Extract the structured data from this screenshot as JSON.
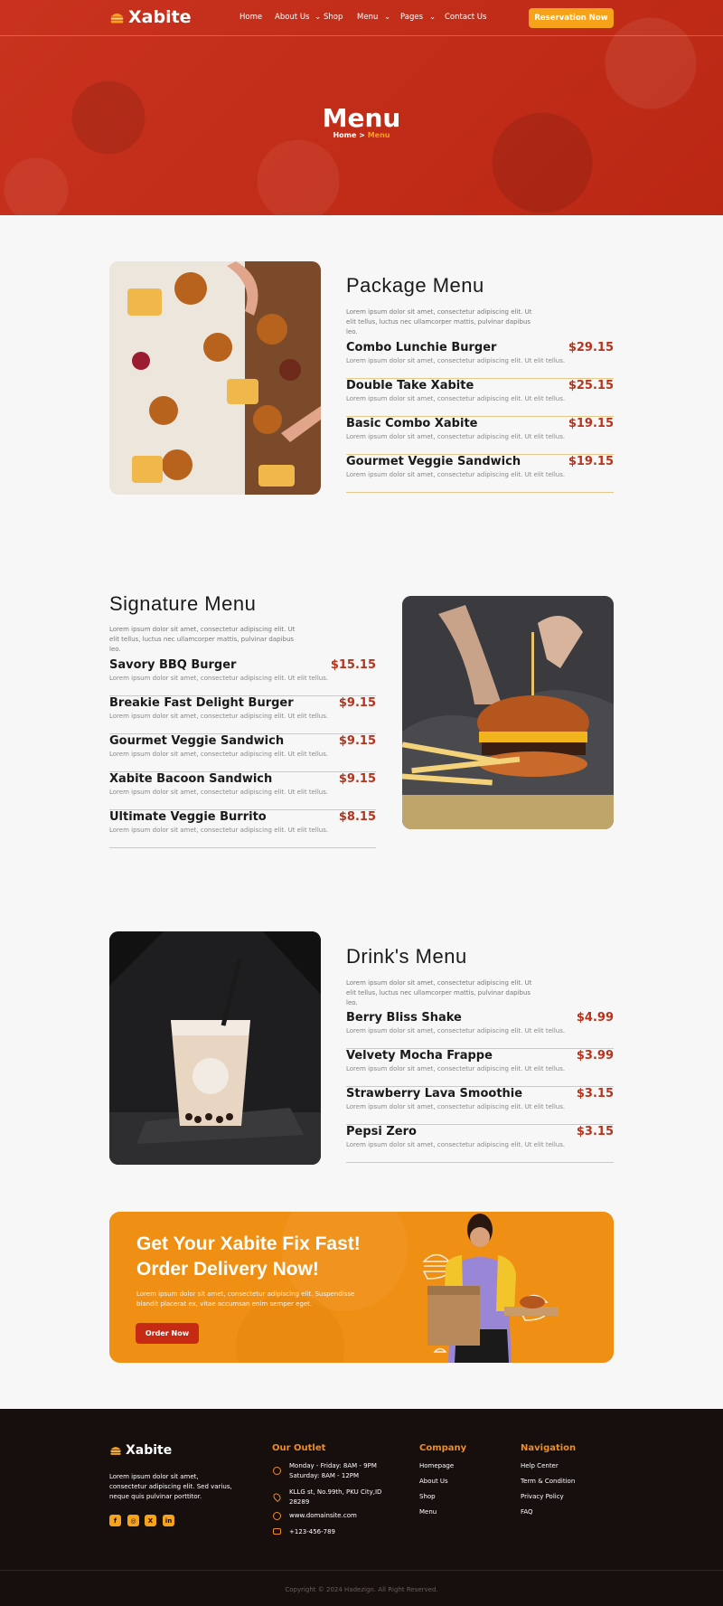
{
  "brand": "Xabite",
  "nav": {
    "items": [
      "Home",
      "About Us",
      "Shop",
      "Menu",
      "Pages",
      "Contact Us"
    ],
    "cta": "Reservation Now"
  },
  "hero": {
    "title": "Menu",
    "crumb_home": "Home",
    "crumb_sep": " > ",
    "crumb_current": "Menu"
  },
  "package": {
    "title": "Package Menu",
    "intro": "Lorem ipsum dolor sit amet, consectetur adipiscing elit. Ut elit tellus, luctus nec ullamcorper mattis, pulvinar dapibus leo.",
    "items": [
      {
        "name": "Combo Lunchie Burger",
        "price": "$29.15",
        "desc": "Lorem ipsum dolor sit amet, consectetur adipiscing elit. Ut elit tellus."
      },
      {
        "name": "Double Take Xabite",
        "price": "$25.15",
        "desc": "Lorem ipsum dolor sit amet, consectetur adipiscing elit. Ut elit tellus."
      },
      {
        "name": "Basic Combo Xabite",
        "price": "$19.15",
        "desc": "Lorem ipsum dolor sit amet, consectetur adipiscing elit. Ut elit tellus."
      },
      {
        "name": "Gourmet Veggie Sandwich",
        "price": "$19.15",
        "desc": "Lorem ipsum dolor sit amet, consectetur adipiscing elit. Ut elit tellus."
      }
    ]
  },
  "signature": {
    "title": "Signature Menu",
    "intro": "Lorem ipsum dolor sit amet, consectetur adipiscing elit. Ut elit tellus, luctus nec ullamcorper mattis, pulvinar dapibus leo.",
    "items": [
      {
        "name": "Savory BBQ Burger",
        "price": "$15.15",
        "desc": "Lorem ipsum dolor sit amet, consectetur adipiscing elit. Ut elit tellus."
      },
      {
        "name": "Breakie Fast Delight Burger",
        "price": "$9.15",
        "desc": "Lorem ipsum dolor sit amet, consectetur adipiscing elit. Ut elit tellus."
      },
      {
        "name": "Gourmet Veggie Sandwich",
        "price": "$9.15",
        "desc": "Lorem ipsum dolor sit amet, consectetur adipiscing elit. Ut elit tellus."
      },
      {
        "name": "Xabite Bacoon Sandwich",
        "price": "$9.15",
        "desc": "Lorem ipsum dolor sit amet, consectetur adipiscing elit. Ut elit tellus."
      },
      {
        "name": "Ultimate Veggie Burrito",
        "price": "$8.15",
        "desc": "Lorem ipsum dolor sit amet, consectetur adipiscing elit. Ut elit tellus."
      }
    ]
  },
  "drinks": {
    "title": "Drink's Menu",
    "intro": "Lorem ipsum dolor sit amet, consectetur adipiscing elit. Ut elit tellus, luctus nec ullamcorper mattis, pulvinar dapibus leo.",
    "items": [
      {
        "name": "Berry Bliss Shake",
        "price": "$4.99",
        "desc": "Lorem ipsum dolor sit amet, consectetur adipiscing elit. Ut elit tellus."
      },
      {
        "name": "Velvety Mocha Frappe",
        "price": "$3.99",
        "desc": "Lorem ipsum dolor sit amet, consectetur adipiscing elit. Ut elit tellus."
      },
      {
        "name": "Strawberry Lava Smoothie",
        "price": "$3.15",
        "desc": "Lorem ipsum dolor sit amet, consectetur adipiscing elit. Ut elit tellus."
      },
      {
        "name": "Pepsi Zero",
        "price": "$3.15",
        "desc": "Lorem ipsum dolor sit amet, consectetur adipiscing elit. Ut elit tellus."
      }
    ]
  },
  "banner": {
    "title_line1": "Get Your Xabite Fix Fast!",
    "title_line2": "Order Delivery Now!",
    "text": "Lorem ipsum dolor sit amet, consectetur adipiscing elit. Suspendisse blandit placerat ex, vitae accumsan enim semper eget.",
    "button": "Order Now"
  },
  "footer": {
    "about": "Lorem ipsum dolor sit amet, consectetur adipiscing elit. Sed varius, neque quis pulvinar porttitor.",
    "social_icons": [
      "facebook-icon",
      "instagram-icon",
      "x-icon",
      "linkedin-icon"
    ],
    "outlet_title": "Our Outlet",
    "hours_1": "Monday - Friday: 8AM - 9PM",
    "hours_2": "Saturday: 8AM - 12PM",
    "address": "KLLG st, No.99th, PKU City,ID 28289",
    "website": "www.domainsite.com",
    "phone": "+123-456-789",
    "company_title": "Company",
    "company_links": [
      "Homepage",
      "About Us",
      "Shop",
      "Menu"
    ],
    "navigation_title": "Navigation",
    "navigation_links": [
      "Help Center",
      "Term & Condition",
      "Privacy Policy",
      "FAQ"
    ],
    "copyright": "Copyright © 2024 Hadezign. All Right Reserved."
  },
  "colors": {
    "primary": "#c62a15",
    "accent": "#f7a21b",
    "price": "#b8331c",
    "footer": "#160f0e"
  }
}
